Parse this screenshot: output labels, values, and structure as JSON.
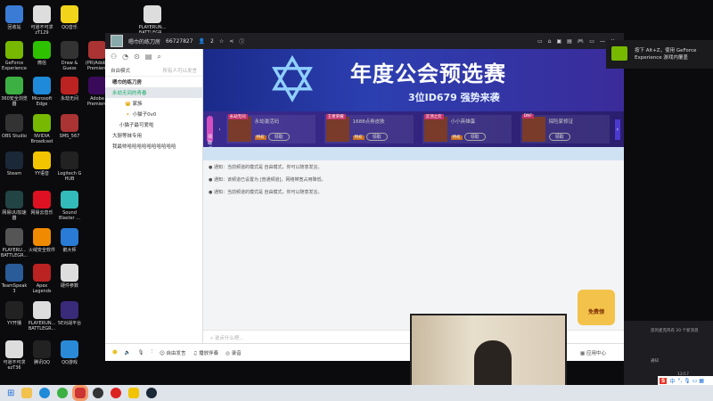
{
  "desktop": {
    "icons": [
      {
        "label": "回收站",
        "color": "#3a7bd5"
      },
      {
        "label": "可道不可求 zT129",
        "color": "#ddd"
      },
      {
        "label": "QQ音乐",
        "color": "#f2d51a"
      },
      {
        "label": "PLAYERUN... BATTLEGR...",
        "color": "#ddd"
      },
      {
        "label": "GeForce Experience",
        "color": "#76b900"
      },
      {
        "label": "微信",
        "color": "#2dc100"
      },
      {
        "label": "Draw & Guess",
        "color": "#333"
      },
      {
        "label": "(PR)Adobe Premiere",
        "color": "#a33"
      },
      {
        "label": "360安全浏览器",
        "color": "#3cb043"
      },
      {
        "label": "Microsoft Edge",
        "color": "#1f8ad8"
      },
      {
        "label": "永劫无间",
        "color": "#b22"
      },
      {
        "label": "Adobe Premiere",
        "color": "#3a0a5a"
      },
      {
        "label": "OBS Studio",
        "color": "#333"
      },
      {
        "label": "NVIDIA Broadcast",
        "color": "#76b900"
      },
      {
        "label": "SMS_567",
        "color": "#a33"
      },
      {
        "label": "Steam",
        "color": "#1b2838"
      },
      {
        "label": "YY语音",
        "color": "#f2c400"
      },
      {
        "label": "Logitech G HUB",
        "color": "#222"
      },
      {
        "label": "网易UU加速器",
        "color": "#244"
      },
      {
        "label": "网易云音乐",
        "color": "#d12"
      },
      {
        "label": "Sound Blaster ...",
        "color": "#3bb"
      },
      {
        "label": "PLAYERU... BATTLEGR...",
        "color": "#555"
      },
      {
        "label": "火绒安全软件",
        "color": "#f08a00"
      },
      {
        "label": "鹅大师",
        "color": "#2a7bd5"
      },
      {
        "label": "TeamSpeak 3",
        "color": "#2a5c9a"
      },
      {
        "label": "Apex Legends",
        "color": "#b22"
      },
      {
        "label": "硬件参数",
        "color": "#ddd"
      },
      {
        "label": "YY开播",
        "color": "#222"
      },
      {
        "label": "PLAYERUN... BATTLEGR...",
        "color": "#ddd"
      },
      {
        "label": "5E对战平台",
        "color": "#3a2a7a"
      },
      {
        "label": "可道不可求 ezT36",
        "color": "#ddd"
      },
      {
        "label": "腾讯QQ",
        "color": "#222"
      },
      {
        "label": "QQ游戏",
        "color": "#2a8ad8"
      }
    ]
  },
  "window": {
    "channel_name": "嗯巾的练刀房",
    "channel_id": "66727827",
    "online": "2",
    "mode": "自由模式",
    "mode_hint": "所有人可以发言",
    "tree": [
      "嗯巾的练刀房",
      "永劫无间的青春",
      "家族",
      "小猫子0v0",
      "小猫子最可爱啦",
      "大厨等妹专用",
      "我最帅哈哈哈哈哈哈哈哈哈哈"
    ],
    "banner_title": "年度公会预选赛",
    "banner_sub": "3位ID679 强势来袭",
    "strip_badge": "领取福利",
    "cards": [
      {
        "tag": "永劫无间",
        "name": "永劫激活码",
        "btn": "领取",
        "r": "特权"
      },
      {
        "tag": "王者荣耀",
        "name": "1688点券皮肤",
        "btn": "领取",
        "r": "特权"
      },
      {
        "tag": "云顶之弈",
        "name": "小小英雄蛋",
        "btn": "领取",
        "r": "特权"
      },
      {
        "tag": "DNF",
        "name": "探险家修证",
        "btn": "领取",
        "r": ""
      }
    ],
    "messages": [
      "通知：当前频道的模式是 自由模式，你可以随意发言。",
      "通知：该频道已设置为 [普通频道]，网络带宽占用降低。",
      "通知：当前频道的模式是 自由模式，你可以随意发言。"
    ],
    "input_placeholder": "说点什么吧...",
    "toolbar": {
      "free": "自由发言",
      "music": "播放伴奏",
      "record": "录音",
      "apps": "应用中心"
    },
    "promo": "免费领"
  },
  "notification": {
    "text": "按下 Alt+Z，使用 GeForce Experience 游戏内覆盖"
  },
  "side": {
    "n1": "您的麦克风有 20 个新消息",
    "n2": "通知",
    "time": "12/17"
  },
  "ime": {
    "lang": "中"
  }
}
